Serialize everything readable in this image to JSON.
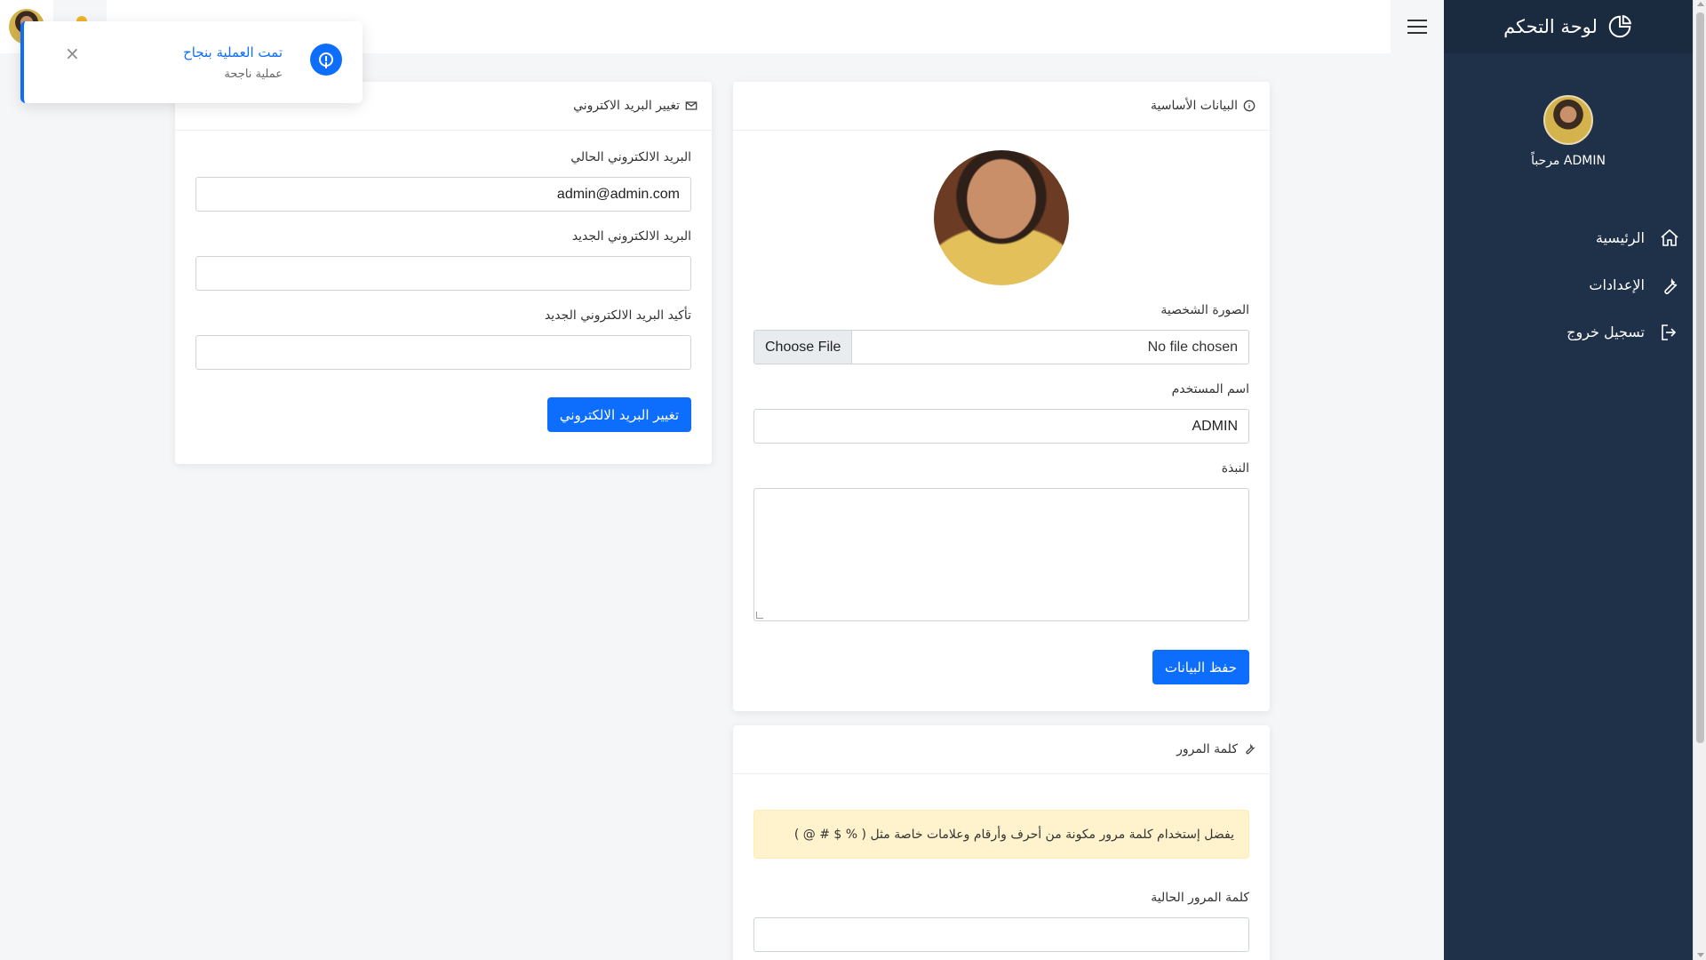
{
  "sidebar": {
    "title": "لوحة التحكم",
    "welcome": "مرحباً ADMIN",
    "items": [
      {
        "label": "الرئيسية"
      },
      {
        "label": "الإعدادات"
      },
      {
        "label": "تسجيل خروج"
      }
    ]
  },
  "toast": {
    "title": "تمت العملية بنجاح",
    "subtitle": "عملية ناجحة",
    "close": "×"
  },
  "basic": {
    "header": "البيانات الأساسية",
    "photo_label": "الصورة الشخصية",
    "choose_file": "Choose File",
    "file_status": "No file chosen",
    "username_label": "اسم المستخدم",
    "username_value": "ADMIN",
    "bio_label": "النبذة",
    "save_button": "حفظ البيانات"
  },
  "email": {
    "header": "تغيير البريد الاكتروني",
    "current_label": "البريد الالكتروني الحالي",
    "current_value": "admin@admin.com",
    "new_label": "البريد الالكتروني الجديد",
    "confirm_label": "تأكيد البريد الالكتروني الجديد",
    "submit_button": "تغيير البريد الالكتروني"
  },
  "password": {
    "header": "كلمة المرور",
    "alert": "يفضل إستخدام كلمة مرور مكونة من أحرف وأرقام وعلامات خاصة مثل ( % $ # @ )",
    "current_label": "كلمة المرور الحالية"
  },
  "colors": {
    "sidebar": "#1e3148",
    "primary": "#0d6efd",
    "alert_bg": "#fff3cd"
  }
}
